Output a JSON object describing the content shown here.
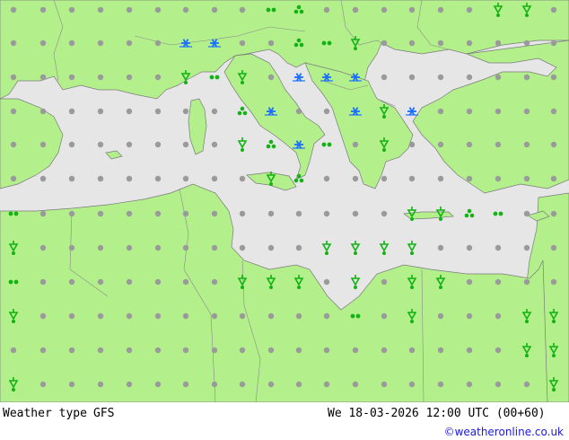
{
  "header": {
    "title": "Weather type",
    "model": "GFS",
    "valid_time": "We 18-03-2026 12:00 UTC (00+60)"
  },
  "credit": "©weatheronline.co.uk",
  "colors": {
    "land": "#b3f08c",
    "sea": "#e6e6e6",
    "dry_symbol": "#9a9a9a",
    "rain_symbol": "#12b312",
    "snow_symbol": "#1a6fff"
  },
  "legend_symbols": [
    "dry-dot",
    "light-rain",
    "shower",
    "thunder-shower",
    "snow"
  ]
}
